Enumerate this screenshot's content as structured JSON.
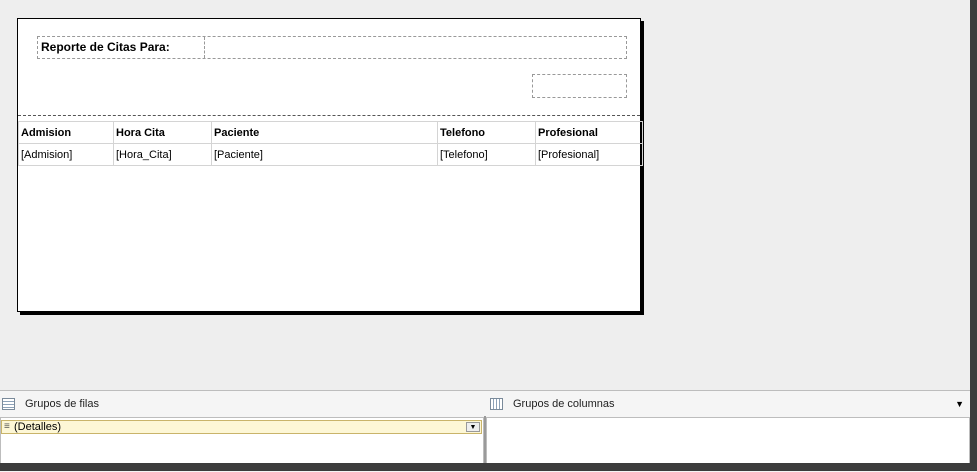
{
  "report": {
    "title_label": "Reporte de Citas Para:",
    "columns": [
      "Admision",
      "Hora Cita",
      "Paciente",
      "Telefono",
      "Profesional"
    ],
    "detail_row": [
      "[Admision]",
      "[Hora_Cita]",
      "[Paciente]",
      "[Telefono]",
      "[Profesional]"
    ]
  },
  "groups": {
    "rows_title": "Grupos de filas",
    "cols_title": "Grupos de columnas",
    "row_items": [
      {
        "label": "(Detalles)",
        "icon": "detail-lines-icon"
      }
    ],
    "menu_arrow": "▼",
    "item_drop": "▼",
    "item_icon": "≡"
  }
}
